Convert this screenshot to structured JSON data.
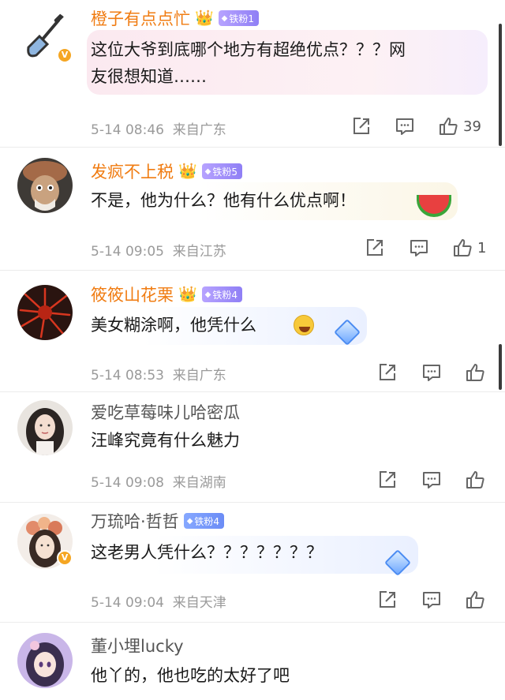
{
  "comments": [
    {
      "username": "橙子有点点忙",
      "fan_badge": "铁粉1",
      "text_line1": "这位大爷到底哪个地方有超绝优点？？？网",
      "text_line2": "友很想知道……",
      "time": "5-14 08:46",
      "location": "来自广东",
      "like_count": "39"
    },
    {
      "username": "发疯不上税",
      "fan_badge": "铁粉5",
      "text": "不是，他为什么？他有什么优点啊！",
      "time": "5-14 09:05",
      "location": "来自江苏",
      "like_count": "1"
    },
    {
      "username": "筱筱山花栗",
      "fan_badge": "铁粉4",
      "text": "美女糊涂啊，他凭什么",
      "time": "5-14 08:53",
      "location": "来自广东",
      "like_count": ""
    },
    {
      "username": "爱吃草莓味儿哈密瓜",
      "text": "汪峰究竟有什么魅力",
      "time": "5-14 09:08",
      "location": "来自湖南",
      "like_count": ""
    },
    {
      "username": "万琉哈·哲哲",
      "fan_badge": "铁粉4",
      "text": "这老男人凭什么？？？？？？？",
      "time": "5-14 09:04",
      "location": "来自天津",
      "like_count": ""
    },
    {
      "username": "董小埋lucky",
      "text": "他丫的，他也吃的太好了吧"
    }
  ],
  "colors": {
    "orange_name": "#f07c12",
    "meta_gray": "#9a9a9a",
    "verified_badge": "#f5a623"
  },
  "icons": {
    "share": "share-icon",
    "comment": "comment-icon",
    "like": "thumbs-up-icon",
    "crown": "crown-icon",
    "verified": "verified-v-icon",
    "emoji_watermelon": "watermelon-emoji",
    "emoji_laugh_cry": "laugh-cry-emoji",
    "diamond_sticker": "diamond-sticker"
  }
}
